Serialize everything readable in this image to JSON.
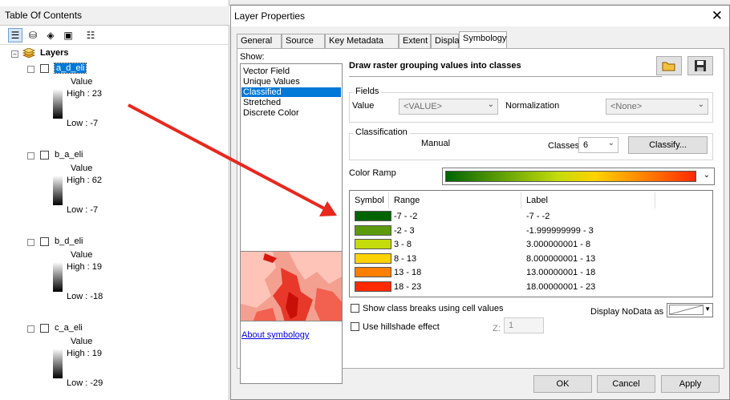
{
  "toc": {
    "title": "Table Of Contents",
    "root": "Layers",
    "layers": [
      {
        "name": "a_d_eli",
        "field": "Value",
        "high": "High : 23",
        "low": "Low : -7",
        "selected": true
      },
      {
        "name": "b_a_eli",
        "field": "Value",
        "high": "High : 62",
        "low": "Low : -7",
        "selected": false
      },
      {
        "name": "b_d_eli",
        "field": "Value",
        "high": "High : 19",
        "low": "Low : -18",
        "selected": false
      },
      {
        "name": "c_a_eli",
        "field": "Value",
        "high": "High : 19",
        "low": "Low : -29",
        "selected": false
      }
    ]
  },
  "dialog": {
    "title": "Layer Properties",
    "close": "✕",
    "tabs": [
      "General",
      "Source",
      "Key Metadata",
      "Extent",
      "Display",
      "Symbology"
    ],
    "show_label": "Show:",
    "show_items": [
      "Vector Field",
      "Unique Values",
      "Classified",
      "Stretched",
      "Discrete Color"
    ],
    "selected_show": "Classified",
    "heading": "Draw raster grouping values into classes",
    "fields_label": "Fields",
    "value_label": "Value",
    "value_field": "<VALUE>",
    "normalization_label": "Normalization",
    "normalization_value": "<None>",
    "classification_label": "Classification",
    "method": "Manual",
    "classes_label": "Classes",
    "classes_value": "6",
    "classify_button": "Classify...",
    "color_ramp_label": "Color Ramp",
    "table_headers": [
      "Symbol",
      "Range",
      "Label"
    ],
    "classes": [
      {
        "range": "-7 - -2",
        "label": "-7 - -2",
        "color": "#006400"
      },
      {
        "range": "-2 - 3",
        "label": "-1.999999999 - 3",
        "color": "#5c9a0d"
      },
      {
        "range": "3 - 8",
        "label": "3.000000001 - 8",
        "color": "#c4dc0b"
      },
      {
        "range": "8 - 13",
        "label": "8.000000001 - 13",
        "color": "#ffd200"
      },
      {
        "range": "13 - 18",
        "label": "13.00000001 - 18",
        "color": "#ff7f00"
      },
      {
        "range": "18 - 23",
        "label": "18.00000001 - 23",
        "color": "#ff2a00"
      }
    ],
    "show_breaks": "Show class breaks using cell values",
    "hillshade": "Use hillshade effect",
    "z_label": "Z:",
    "z_value": "1",
    "nodata_label": "Display NoData as",
    "about_link": "About symbology",
    "ok": "OK",
    "cancel": "Cancel",
    "apply": "Apply"
  },
  "colors": {
    "selection": "#0078d7",
    "arrow": "#e8281e"
  }
}
